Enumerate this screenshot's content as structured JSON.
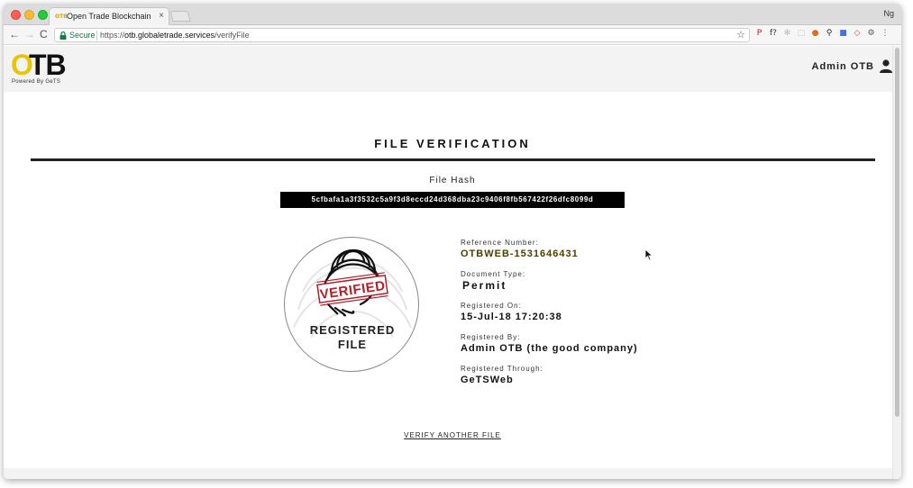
{
  "browser": {
    "tab_title": "Open Trade Blockchain",
    "tab_favicon": "OTB",
    "tab_close": "×",
    "profile": "Ng",
    "secure_label": "Secure",
    "url_scheme": "https://",
    "url_host": "otb.globaletrade.services",
    "url_path": "/verifyFile",
    "back": "←",
    "forward": "→",
    "reload": "C",
    "star": "☆",
    "extensions": [
      {
        "icon": "pinterest-icon",
        "glyph": "P",
        "color": "#e60023"
      },
      {
        "icon": "function-icon",
        "glyph": "f?",
        "color": "#333333"
      },
      {
        "icon": "grey-ext-icon",
        "glyph": "✻",
        "color": "#bbbbbb"
      },
      {
        "icon": "blank-ext-icon",
        "glyph": "□",
        "color": "#cccccc"
      },
      {
        "icon": "orange-ext-icon",
        "glyph": "●",
        "color": "#e06b1a"
      },
      {
        "icon": "magnifier-icon",
        "glyph": "⚲",
        "color": "#222222"
      },
      {
        "icon": "blue-square-icon",
        "glyph": "■",
        "color": "#4a6ee0"
      },
      {
        "icon": "red-ext-icon",
        "glyph": "◇",
        "color": "#e0433e"
      },
      {
        "icon": "settings-ext-icon",
        "glyph": "⚙",
        "color": "#555555"
      },
      {
        "icon": "menu-icon",
        "glyph": "⋮",
        "color": "#555555"
      }
    ]
  },
  "header": {
    "logo_o": "O",
    "logo_tb": "TB",
    "logo_sub": "Powered By GeTS",
    "user_name": "Admin OTB",
    "brand_yellow": "#e8c500"
  },
  "main": {
    "title": "FILE VERIFICATION",
    "hash_label": "File Hash",
    "hash_value": "5cfbafa1a3f3532c5a9f3d8eccd24d368dba23c9406f8fb567422f26dfc8099d",
    "seal": {
      "stamp": "VERIFIED",
      "line1": "REGISTERED",
      "line2": "FILE",
      "stamp_color": "#b3202b"
    },
    "details": [
      {
        "label": "Reference Number:",
        "value": "OTBWEB-1531646431"
      },
      {
        "label": "Document Type:",
        "value": "Permit"
      },
      {
        "label": "Registered On:",
        "value": "15-Jul-18 17:20:38"
      },
      {
        "label": "Registered By:",
        "value": "Admin OTB (the good company)"
      },
      {
        "label": "Registered Through:",
        "value": "GeTSWeb"
      }
    ],
    "verify_link": "VERIFY ANOTHER FILE"
  }
}
